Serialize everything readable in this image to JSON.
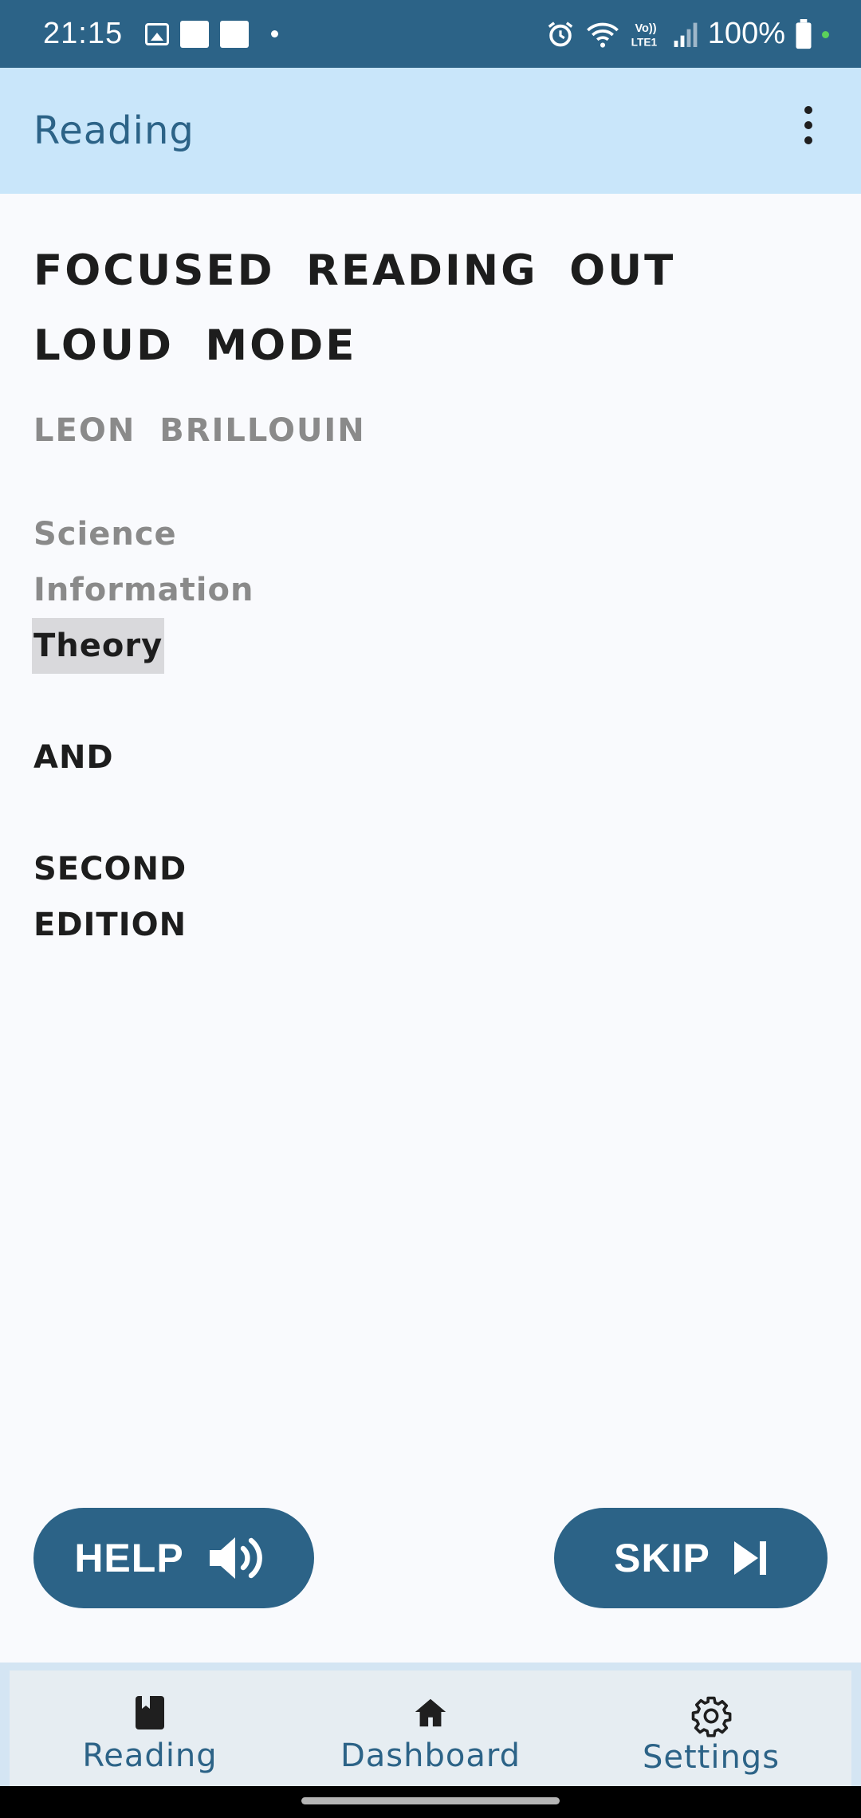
{
  "status_bar": {
    "time": "21:15",
    "battery": "100%",
    "icons": [
      "gallery-icon",
      "notification-square-icon",
      "notification-square-icon",
      "dot-icon",
      "alarm-icon",
      "wifi-icon",
      "volte-icon",
      "signal-icon",
      "battery-icon"
    ]
  },
  "app_bar": {
    "title": "Reading",
    "menu_icon": "more-vert-icon"
  },
  "content": {
    "title": "FOCUSED READING OUT LOUD MODE",
    "author": "LEON BRILLOUIN",
    "words": [
      {
        "text": "Science",
        "state": "read"
      },
      {
        "text": "Information",
        "state": "read"
      },
      {
        "text": "Theory",
        "state": "current"
      },
      {
        "text": "AND",
        "state": "unread"
      },
      {
        "text": "SECOND",
        "state": "unread"
      },
      {
        "text": "EDITION",
        "state": "unread"
      }
    ]
  },
  "buttons": {
    "help": {
      "label": "HELP",
      "icon": "volume-up-icon"
    },
    "skip": {
      "label": "SKIP",
      "icon": "skip-next-icon"
    }
  },
  "bottom_nav": {
    "items": [
      {
        "label": "Reading",
        "icon": "book-icon"
      },
      {
        "label": "Dashboard",
        "icon": "home-icon"
      },
      {
        "label": "Settings",
        "icon": "gear-icon"
      }
    ]
  },
  "colors": {
    "primary": "#2c6387",
    "app_bar_bg": "#c9e6fa",
    "background": "#f9fafd",
    "highlight": "#d9d9dc",
    "read_text": "#8a8a8a",
    "unread_text": "#1d1d1d"
  }
}
